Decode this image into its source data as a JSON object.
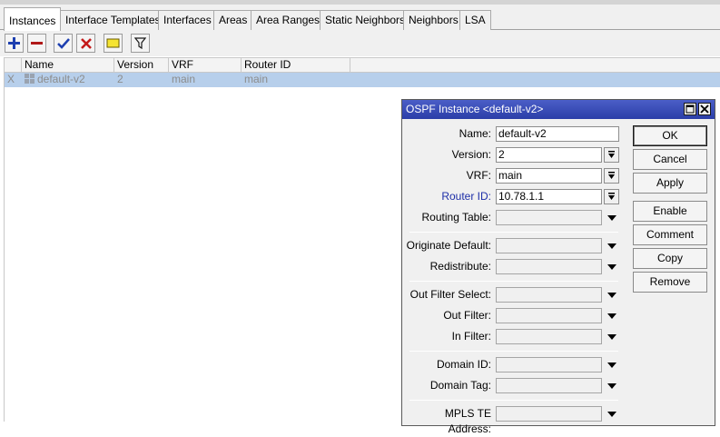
{
  "tabs": [
    "Instances",
    "Interface Templates",
    "Interfaces",
    "Areas",
    "Area Ranges",
    "Static Neighbors",
    "Neighbors",
    "LSA"
  ],
  "toolbar": {
    "icons": [
      "add-icon",
      "remove-icon",
      "enable-check-icon",
      "disable-x-icon",
      "comment-icon",
      "filter-icon"
    ]
  },
  "table": {
    "columns": [
      "Name",
      "Version",
      "VRF",
      "Router ID"
    ],
    "rows": [
      {
        "flag": "X",
        "name": "default-v2",
        "version": "2",
        "vrf": "main",
        "router_id": "main"
      }
    ]
  },
  "dialog": {
    "title": "OSPF Instance <default-v2>",
    "fields": {
      "name": {
        "label": "Name:",
        "value": "default-v2"
      },
      "version": {
        "label": "Version:",
        "value": "2"
      },
      "vrf": {
        "label": "VRF:",
        "value": "main"
      },
      "router_id": {
        "label": "Router ID:",
        "value": "10.78.1.1"
      },
      "routing_table": {
        "label": "Routing Table:",
        "value": ""
      },
      "originate_default": {
        "label": "Originate Default:",
        "value": ""
      },
      "redistribute": {
        "label": "Redistribute:",
        "value": ""
      },
      "out_filter_select": {
        "label": "Out Filter Select:",
        "value": ""
      },
      "out_filter": {
        "label": "Out Filter:",
        "value": ""
      },
      "in_filter": {
        "label": "In Filter:",
        "value": ""
      },
      "domain_id": {
        "label": "Domain ID:",
        "value": ""
      },
      "domain_tag": {
        "label": "Domain Tag:",
        "value": ""
      },
      "mpls_te_address": {
        "label": "MPLS TE Address:",
        "value": ""
      }
    },
    "buttons": {
      "ok": "OK",
      "cancel": "Cancel",
      "apply": "Apply",
      "enable": "Enable",
      "comment": "Comment",
      "copy": "Copy",
      "remove": "Remove"
    }
  },
  "colors": {
    "selected_row": "#b7cfeb",
    "title_bar": "#2b3ea8",
    "link_label": "#1e2fa8"
  }
}
